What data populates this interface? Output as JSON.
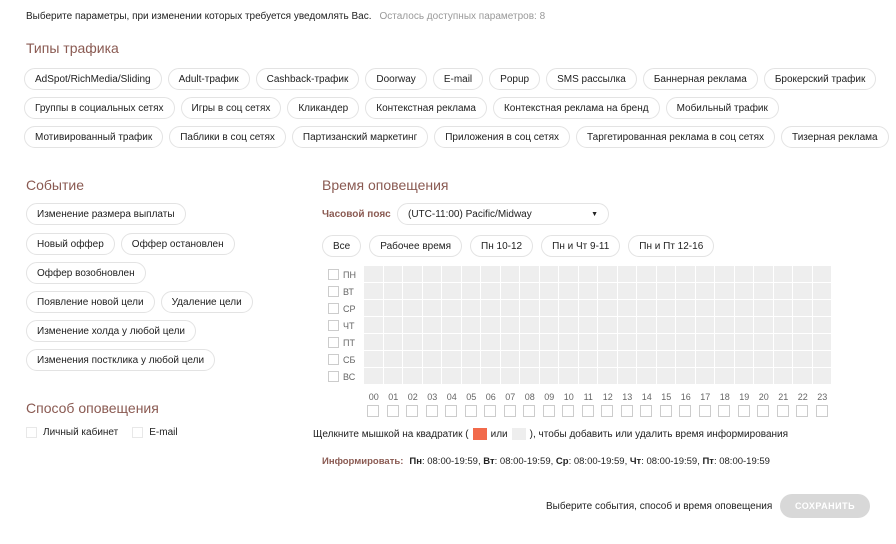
{
  "intro": {
    "text": "Выберите параметры, при изменении которых требуется уведомлять Вас.",
    "remaining": "Осталось доступных параметров: 8"
  },
  "traffic": {
    "title": "Типы трафика",
    "rows": [
      [
        "AdSpot/RichMedia/Sliding",
        "Adult-трафик",
        "Cashback-трафик",
        "Doorway",
        "E-mail",
        "Popup",
        "SMS рассылка",
        "Баннерная реклама",
        "Брокерский трафик"
      ],
      [
        "Группы в социальных сетях",
        "Игры в соц сетях",
        "Кликандер",
        "Контекстная реклама",
        "Контекстная реклама на бренд",
        "Мобильный трафик"
      ],
      [
        "Мотивированный трафик",
        "Паблики в соц сетях",
        "Партизанский маркетинг",
        "Приложения в соц сетях",
        "Таргетированная реклама в соц сетях",
        "Тизерная реклама"
      ]
    ]
  },
  "events": {
    "title": "Событие",
    "rows": [
      [
        "Изменение размера выплаты"
      ],
      [
        "Новый оффер",
        "Оффер остановлен"
      ],
      [
        "Оффер возобновлен"
      ],
      [
        "Появление новой цели",
        "Удаление цели"
      ],
      [
        "Изменение холда у любой цели"
      ],
      [
        "Изменения постклика у любой цели"
      ]
    ]
  },
  "method": {
    "title": "Способ оповещения",
    "options": [
      "Личный кабинет",
      "E-mail"
    ]
  },
  "time": {
    "title": "Время оповещения",
    "tz_label": "Часовой пояс",
    "tz_value": "(UTC-11:00) Pacific/Midway",
    "presets": [
      "Все",
      "Рабочее время",
      "Пн 10-12",
      "Пн и Чт 9-11",
      "Пн и Пт 12-16"
    ],
    "days": [
      "ПН",
      "ВТ",
      "СР",
      "ЧТ",
      "ПТ",
      "СБ",
      "ВС"
    ],
    "hours": [
      "00",
      "01",
      "02",
      "03",
      "04",
      "05",
      "06",
      "07",
      "08",
      "09",
      "10",
      "11",
      "12",
      "13",
      "14",
      "15",
      "16",
      "17",
      "18",
      "19",
      "20",
      "21",
      "22",
      "23"
    ],
    "hint_before": "Щелкните мышкой на квадратик (",
    "hint_or": "или",
    "hint_after": "), чтобы добавить или удалить время информирования",
    "hint_color_on": "#f26a4b",
    "hint_color_off": "#eeeeee",
    "inform_label": "Информировать:",
    "inform": [
      {
        "day": "Пн",
        "range": "08:00-19:59"
      },
      {
        "day": "Вт",
        "range": "08:00-19:59"
      },
      {
        "day": "Ср",
        "range": "08:00-19:59"
      },
      {
        "day": "Чт",
        "range": "08:00-19:59"
      },
      {
        "day": "Пт",
        "range": "08:00-19:59"
      }
    ]
  },
  "footer": {
    "note": "Выберите события, способ и время оповещения",
    "save": "СОХРАНИТЬ"
  }
}
